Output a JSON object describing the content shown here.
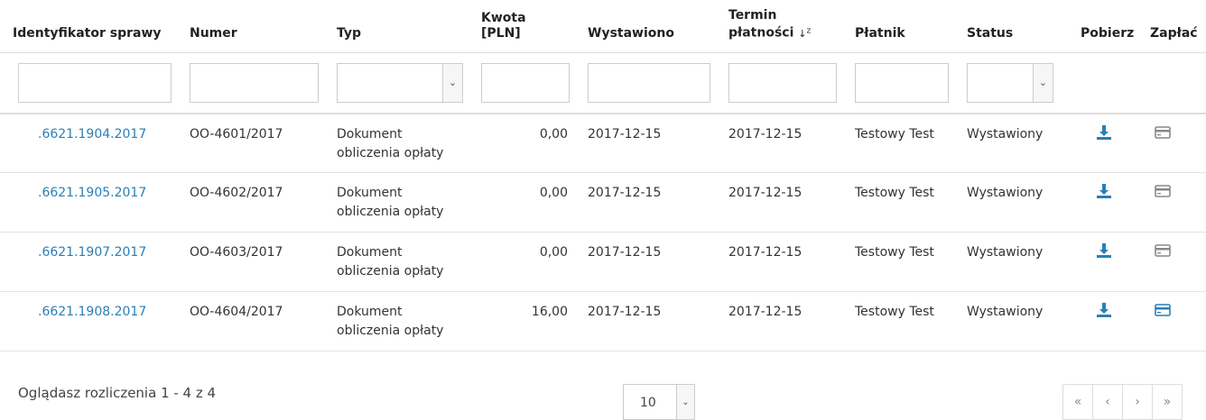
{
  "table": {
    "headers": {
      "id": "Identyfikator sprawy",
      "number": "Numer",
      "type": "Typ",
      "amount_line1": "Kwota",
      "amount_line2": "[PLN]",
      "issued": "Wystawiono",
      "due_line1": "Termin",
      "due_line2": "płatności",
      "payer": "Płatnik",
      "status": "Status",
      "download": "Pobierz",
      "pay": "Zapłać"
    },
    "rows": [
      {
        "id": ".6621.1904.2017",
        "number": "OO-4601/2017",
        "type_line1": "Dokument",
        "type_line2": "obliczenia opłaty",
        "amount": "0,00",
        "issued": "2017-12-15",
        "due": "2017-12-15",
        "payer": "Testowy Test",
        "status": "Wystawiony",
        "pay_active": false
      },
      {
        "id": ".6621.1905.2017",
        "number": "OO-4602/2017",
        "type_line1": "Dokument",
        "type_line2": "obliczenia opłaty",
        "amount": "0,00",
        "issued": "2017-12-15",
        "due": "2017-12-15",
        "payer": "Testowy Test",
        "status": "Wystawiony",
        "pay_active": false
      },
      {
        "id": ".6621.1907.2017",
        "number": "OO-4603/2017",
        "type_line1": "Dokument",
        "type_line2": "obliczenia opłaty",
        "amount": "0,00",
        "issued": "2017-12-15",
        "due": "2017-12-15",
        "payer": "Testowy Test",
        "status": "Wystawiony",
        "pay_active": false
      },
      {
        "id": ".6621.1908.2017",
        "number": "OO-4604/2017",
        "type_line1": "Dokument",
        "type_line2": "obliczenia opłaty",
        "amount": "16,00",
        "issued": "2017-12-15",
        "due": "2017-12-15",
        "payer": "Testowy Test",
        "status": "Wystawiony",
        "pay_active": true
      }
    ]
  },
  "footer": {
    "summary": "Oglądasz rozliczenia 1 - 4 z 4",
    "page_size": "10"
  },
  "colors": {
    "link": "#2a7fb5",
    "icon_active": "#2a7fb5",
    "icon_inactive": "#888888"
  },
  "icons": {
    "sort": "sort-desc-icon",
    "download": "download-icon",
    "pay": "credit-card-icon",
    "first": "double-chevron-left-icon",
    "prev": "chevron-left-icon",
    "next": "chevron-right-icon",
    "last": "double-chevron-right-icon"
  }
}
